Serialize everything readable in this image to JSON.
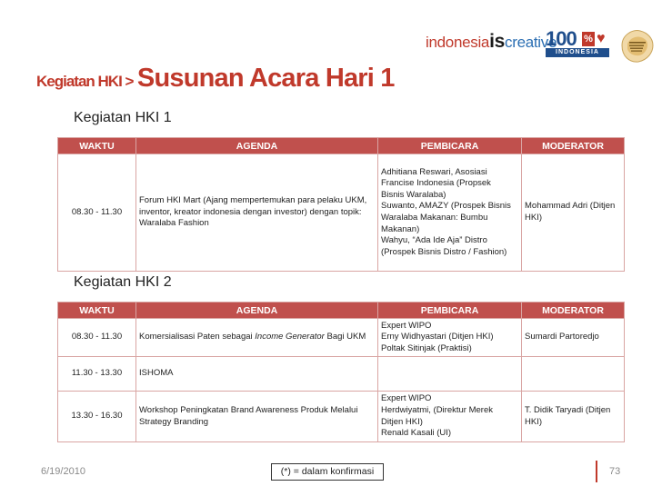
{
  "header": {
    "logo_indonesia": "indonesia",
    "logo_is": "is",
    "logo_creative": "creative",
    "logo_100": "100",
    "logo_pct": "%",
    "logo_band": "INDONESIA",
    "emblem_icon": "hki-emblem-icon"
  },
  "title": {
    "prefix": "Kegiatan HKI >",
    "main": "Susunan Acara Hari 1"
  },
  "table_headers": [
    "WAKTU",
    "AGENDA",
    "PEMBICARA",
    "MODERATOR"
  ],
  "section1": {
    "title": "Kegiatan HKI 1",
    "rows": [
      {
        "time": "08.30 - 11.30",
        "agenda": "Forum HKI Mart (Ajang mempertemukan para pelaku UKM, inventor, kreator indonesia dengan investor) dengan topik: Waralaba Fashion",
        "pembicara": [
          "Adhitiana Reswari, Asosiasi",
          "Francise Indonesia (Propsek",
          "Bisnis Waralaba)",
          "Suwanto, AMAZY (Prospek Bisnis",
          "Waralaba Makanan: Bumbu",
          "Makanan)",
          "Wahyu, “Ada Ide Aja”  Distro",
          "(Prospek Bisnis Distro / Fashion)"
        ],
        "moderator": "Mohammad Adri (Ditjen HKI)"
      }
    ]
  },
  "section2": {
    "title": "Kegiatan HKI 2",
    "rows": [
      {
        "time": "08.30 - 11.30",
        "agenda_pre": "Komersialisasi Paten sebagai ",
        "agenda_italic": "Income Generator",
        "agenda_post": " Bagi UKM",
        "pembicara": [
          "Expert WIPO",
          "Erny Widhyastari (Ditjen HKI)",
          "Poltak Sitinjak (Praktisi)"
        ],
        "moderator": "Sumardi Partoredjo"
      },
      {
        "time": "11.30 - 13.30",
        "agenda": "ISHOMA",
        "pembicara": [],
        "moderator": ""
      },
      {
        "time": "13.30 - 16.30",
        "agenda": "Workshop Peningkatan Brand Awareness Produk Melalui Strategy Branding",
        "pembicara": [
          "Expert WIPO",
          "Herdwiyatmi, (Direktur Merek",
          "Ditjen HKI)",
          "Renald Kasali (UI)"
        ],
        "moderator": "T. Didik Taryadi (Ditjen HKI)"
      }
    ]
  },
  "footer": {
    "date": "6/19/2010",
    "note": "(*) = dalam konfirmasi",
    "page": "73"
  },
  "colors": {
    "accent": "#c0392b",
    "table_header": "#c0504d"
  }
}
